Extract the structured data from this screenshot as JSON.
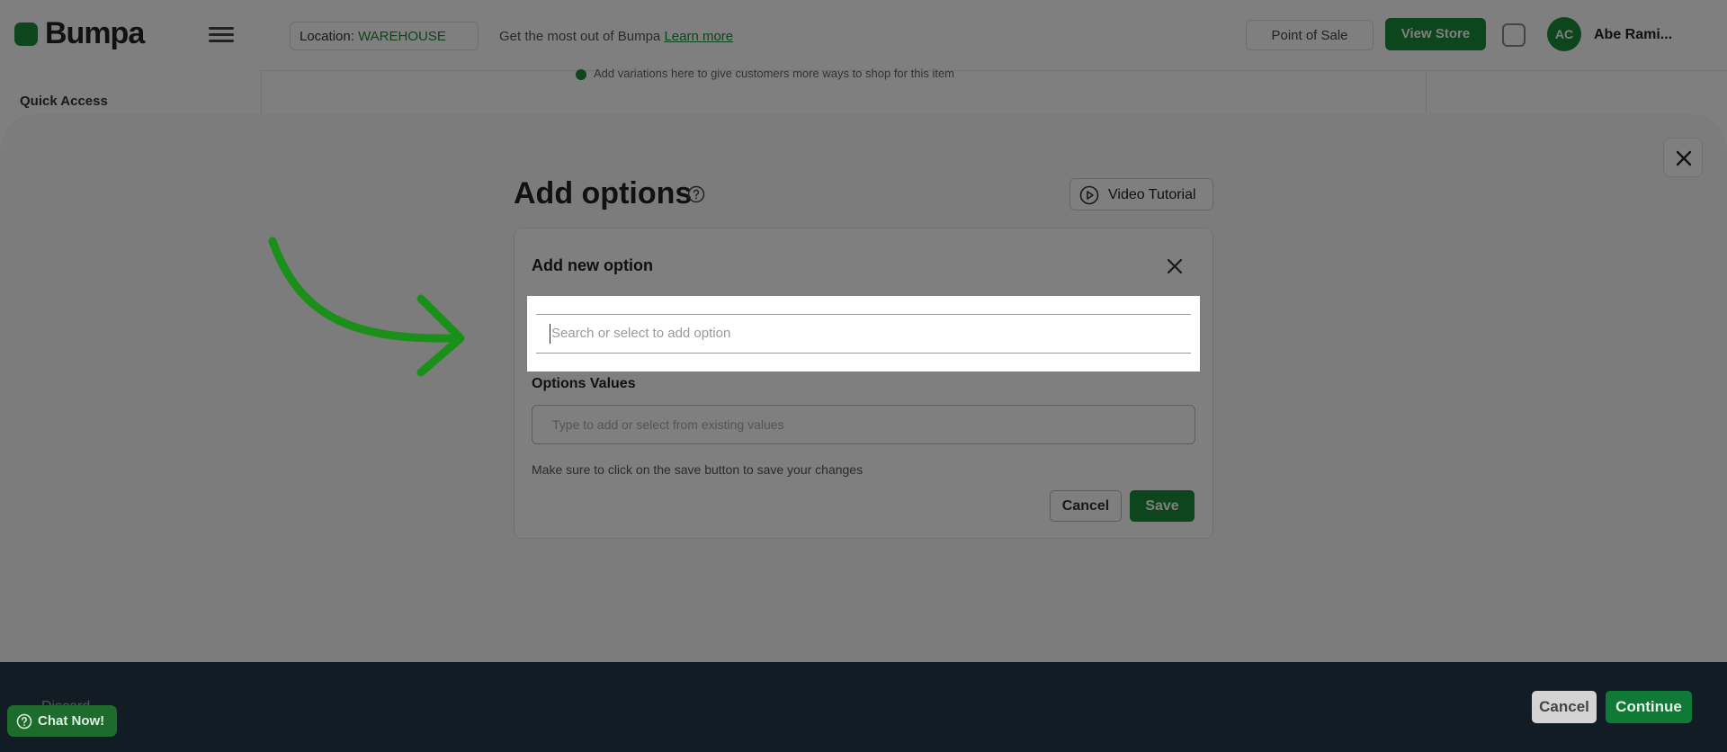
{
  "app": {
    "logo_text": "Bumpa",
    "location_label": "Location:",
    "location_value": "WAREHOUSE",
    "promo_text": "Get the most out of Bumpa",
    "promo_link": "Learn more",
    "pos_label": "Point of Sale",
    "view_store_label": "View Store",
    "avatar_initials": "AC",
    "user_name": "Abe Rami...",
    "quick_access": "Quick Access",
    "bg_note": "Add variations here to give customers more ways to shop for this item"
  },
  "modal": {
    "title": "Add options",
    "video_tutorial_label": "Video Tutorial",
    "card": {
      "title": "Add new option",
      "search_placeholder": "Search or select to add option",
      "values_label": "Options Values",
      "values_placeholder": "Type to add or select from existing values",
      "hint": "Make sure to click on the save button to save your changes",
      "cancel_label": "Cancel",
      "save_label": "Save"
    }
  },
  "footer": {
    "discard_label": "Discard",
    "cancel_label": "Cancel",
    "continue_label": "Continue"
  },
  "chat": {
    "label": "Chat Now!"
  },
  "colors": {
    "brand_green": "#1b8a3a",
    "footer_bg": "#121c24",
    "annotation_arrow": "#1a8f1a"
  }
}
